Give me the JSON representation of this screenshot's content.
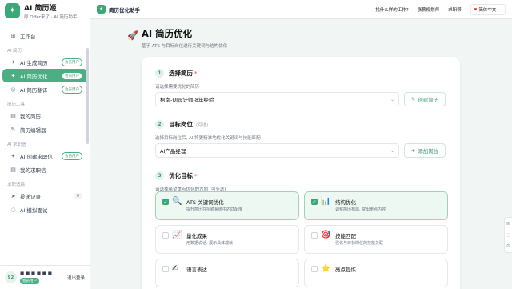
{
  "brand": {
    "name": "AI 简历姬",
    "tagline": "原 Offer来了 · AI 简历助手"
  },
  "sidebar": {
    "workbench": "工作台",
    "section_ai": "AI 简历",
    "ai_generate": "AI 生成简历",
    "ai_optimize": "AI 简历优化",
    "ai_translate": "AI 简历翻译",
    "member_badge": "会员用户",
    "section_tools": "简历工具",
    "my_resumes": "我的简历",
    "resume_editor": "简历编辑器",
    "section_jobs": "AI 求职信",
    "ai_cover": "AI 创建求职信",
    "my_covers": "我的求职信",
    "section_track": "求职追踪",
    "delivery": "投递记录",
    "delivery_count": "0",
    "interview": "AI 模拟面试"
  },
  "user": {
    "avatar": "92",
    "name": "■ ■ ■ ■ ■ ■",
    "badge": "会员用户",
    "logout": "退出登录"
  },
  "topbar": {
    "title": "简历优化助手",
    "nav": [
      "找什么样的工作?",
      "涨薪规划师",
      "求职帮"
    ],
    "lang": "简体中文"
  },
  "page": {
    "title": "AI 简历优化",
    "subtitle": "基于 ATS 与目标岗位进行关键词与结构优化"
  },
  "step1": {
    "num": "1",
    "title": "选择简历",
    "hint": "请选择需要优化的简历",
    "value": "柯南-UI设计师-8年经验",
    "button": "创建简历"
  },
  "step2": {
    "num": "2",
    "title": "目标岗位",
    "optional": "(可选)",
    "hint": "选择目标岗位后, AI 将更精准地优化关键词与技能匹配",
    "value": "AI产品经理",
    "button": "添加岗位"
  },
  "step3": {
    "num": "3",
    "title": "优化目标",
    "hint": "请选择希望重点优化的方向 (可多选)",
    "options": [
      {
        "title": "ATS 关键词优化",
        "desc": "提升简历在招聘系统中的匹配度",
        "icon": "🔍",
        "checked": true
      },
      {
        "title": "结构优化",
        "desc": "调整简历布局, 突出重点内容",
        "icon": "📊",
        "checked": true
      },
      {
        "title": "量化成果",
        "desc": "用数据说话, 展示具体成就",
        "icon": "📈",
        "checked": false
      },
      {
        "title": "技能匹配",
        "desc": "强化与目标岗位的技能关联",
        "icon": "🎯",
        "checked": false
      },
      {
        "title": "语言表达",
        "desc": "",
        "icon": "✍",
        "checked": false
      },
      {
        "title": "亮点提炼",
        "desc": "",
        "icon": "⭐",
        "checked": false
      }
    ]
  },
  "colors": {
    "accent": "#4cae84",
    "accent_dark": "#3a9a6e"
  }
}
